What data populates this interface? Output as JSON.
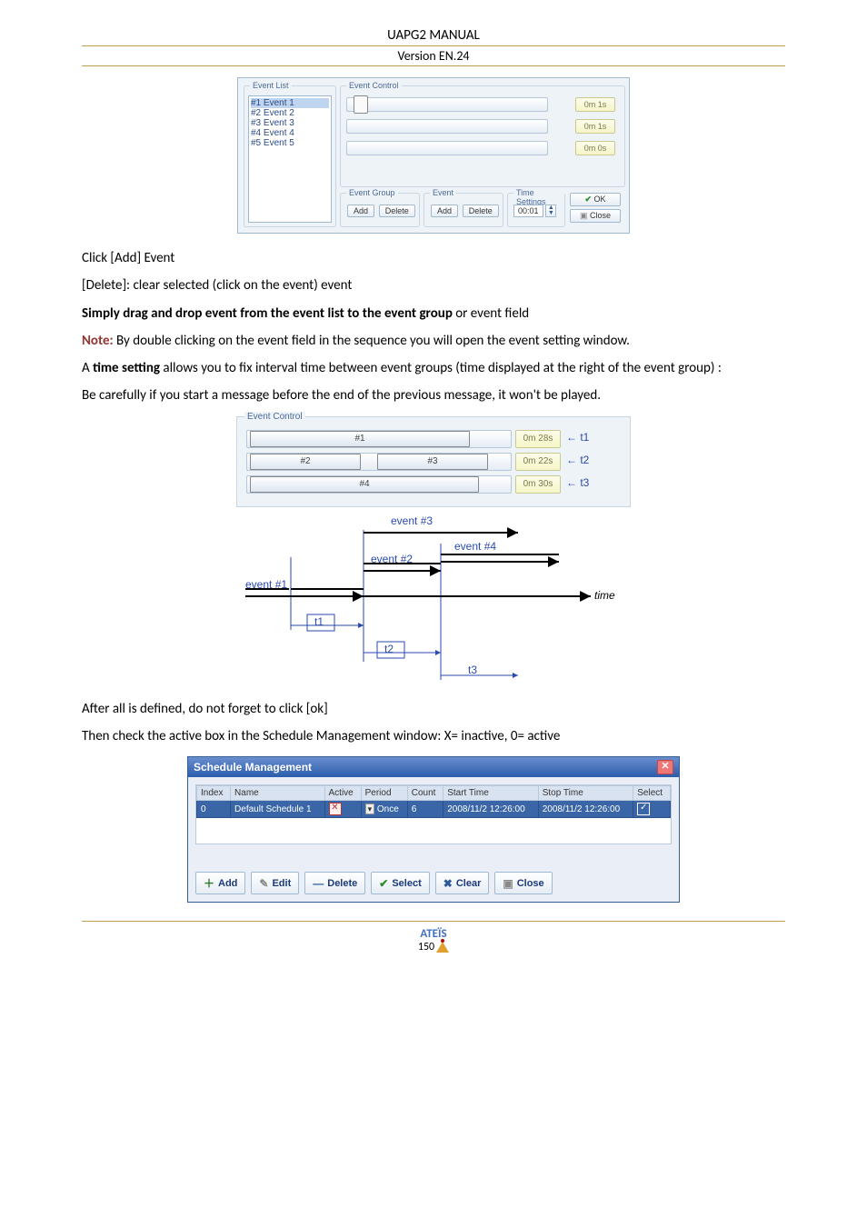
{
  "header": {
    "title": "UAPG2  MANUAL",
    "version": "Version EN.24"
  },
  "dlg1": {
    "event_list_title": "Event List",
    "events": [
      "#1 Event 1",
      "#2 Event 2",
      "#3 Event 3",
      "#4 Event 4",
      "#5 Event 5"
    ],
    "event_control_title": "Event Control",
    "times": [
      "0m 1s",
      "0m 1s",
      "0m 0s"
    ],
    "event_group_title": "Event Group",
    "event_title": "Event",
    "time_settings_title": "Time Settings",
    "add_label": "Add",
    "delete_label": "Delete",
    "time_value": "00:01",
    "ok_label": "OK",
    "close_label": "Close"
  },
  "body_text": {
    "p1": "Click [Add] Event",
    "p2": "[Delete]: clear selected (click on the event) event",
    "p3a": "Simply drag and drop event from the event list to the event group",
    "p3b": " or event field",
    "p4a": "Note:",
    "p4b": " By double clicking on the event field in the sequence you will open the event setting window.",
    "p5a": "A ",
    "p5b": "time setting",
    "p5c": " allows you to fix interval time between event groups (time displayed at the right of the event group) :",
    "p6": "Be carefully if you start a message before the end of the previous message, it won't be played.",
    "p7": "After all is defined, do not forget to click [ok]",
    "p8": "Then check the active box in the Schedule Management window:  X= inactive, 0= active"
  },
  "dlg2": {
    "title": "Event Control",
    "blocks": {
      "r1b1": "#1",
      "r2b1": "#2",
      "r2b2": "#3",
      "r3b1": "#4"
    },
    "times": [
      "0m 28s",
      "0m 22s",
      "0m 30s"
    ],
    "tlabels": [
      "t1",
      "t2",
      "t3"
    ],
    "arrow": "←"
  },
  "diagram": {
    "ev1": "event #1",
    "ev2": "event #2",
    "ev3": "event #3",
    "ev4": "event #4",
    "time": "time",
    "t1": "t1",
    "t2": "t2",
    "t3": "t3"
  },
  "sched": {
    "title": "Schedule Management",
    "headers": [
      "Index",
      "Name",
      "Active",
      "Period",
      "Count",
      "Start Time",
      "Stop Time",
      "Select"
    ],
    "row": {
      "index": "0",
      "name": "Default Schedule 1",
      "period": "Once",
      "count": "6",
      "start": "2008/11/2 12:26:00",
      "stop": "2008/11/2 12:26:00"
    },
    "buttons": {
      "add": "Add",
      "edit": "Edit",
      "delete": "Delete",
      "select": "Select",
      "clear": "Clear",
      "close": "Close"
    }
  },
  "footer": {
    "brand": "ATEÏS",
    "page": "150"
  }
}
